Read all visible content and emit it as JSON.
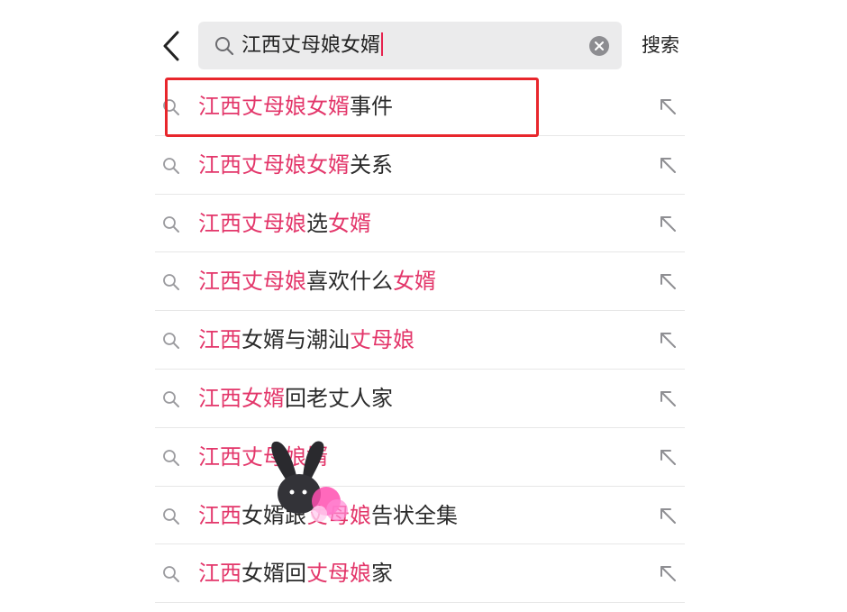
{
  "search": {
    "query": "江西丈母娘女婿",
    "action_label": "搜索"
  },
  "icons": {
    "back": "chevron-left-icon",
    "search": "search-icon",
    "clear": "clear-circle-icon",
    "fill": "arrow-up-left-icon"
  },
  "colors": {
    "highlight": "#e3366a",
    "text": "#2b2b2b",
    "search_bg": "#ebebec",
    "annotation_box": "#e8262c"
  },
  "suggestions": [
    {
      "parts": [
        {
          "t": "江西丈母娘女婿",
          "hl": true
        },
        {
          "t": "事件",
          "hl": false
        }
      ]
    },
    {
      "parts": [
        {
          "t": "江西丈母娘女婿",
          "hl": true
        },
        {
          "t": "关系",
          "hl": false
        }
      ]
    },
    {
      "parts": [
        {
          "t": "江西丈母娘",
          "hl": true
        },
        {
          "t": "选",
          "hl": false
        },
        {
          "t": "女婿",
          "hl": true
        }
      ]
    },
    {
      "parts": [
        {
          "t": "江西丈母娘",
          "hl": true
        },
        {
          "t": "喜欢什么",
          "hl": false
        },
        {
          "t": "女婿",
          "hl": true
        }
      ]
    },
    {
      "parts": [
        {
          "t": "江西",
          "hl": true
        },
        {
          "t": "女婿与潮汕",
          "hl": false
        },
        {
          "t": "丈母娘",
          "hl": true
        }
      ]
    },
    {
      "parts": [
        {
          "t": "江西女婿",
          "hl": true
        },
        {
          "t": "回老丈人家",
          "hl": false
        }
      ]
    },
    {
      "parts": [
        {
          "t": "江西丈母娘",
          "hl": true
        },
        {
          "t": "婿",
          "hl": true
        }
      ]
    },
    {
      "parts": [
        {
          "t": "江西",
          "hl": true
        },
        {
          "t": "女婿跟",
          "hl": false
        },
        {
          "t": "丈母娘",
          "hl": true
        },
        {
          "t": "告状全集",
          "hl": false
        }
      ]
    },
    {
      "parts": [
        {
          "t": "江西",
          "hl": true
        },
        {
          "t": "女婿回",
          "hl": false
        },
        {
          "t": "丈母娘",
          "hl": true
        },
        {
          "t": "家",
          "hl": false
        }
      ]
    }
  ]
}
